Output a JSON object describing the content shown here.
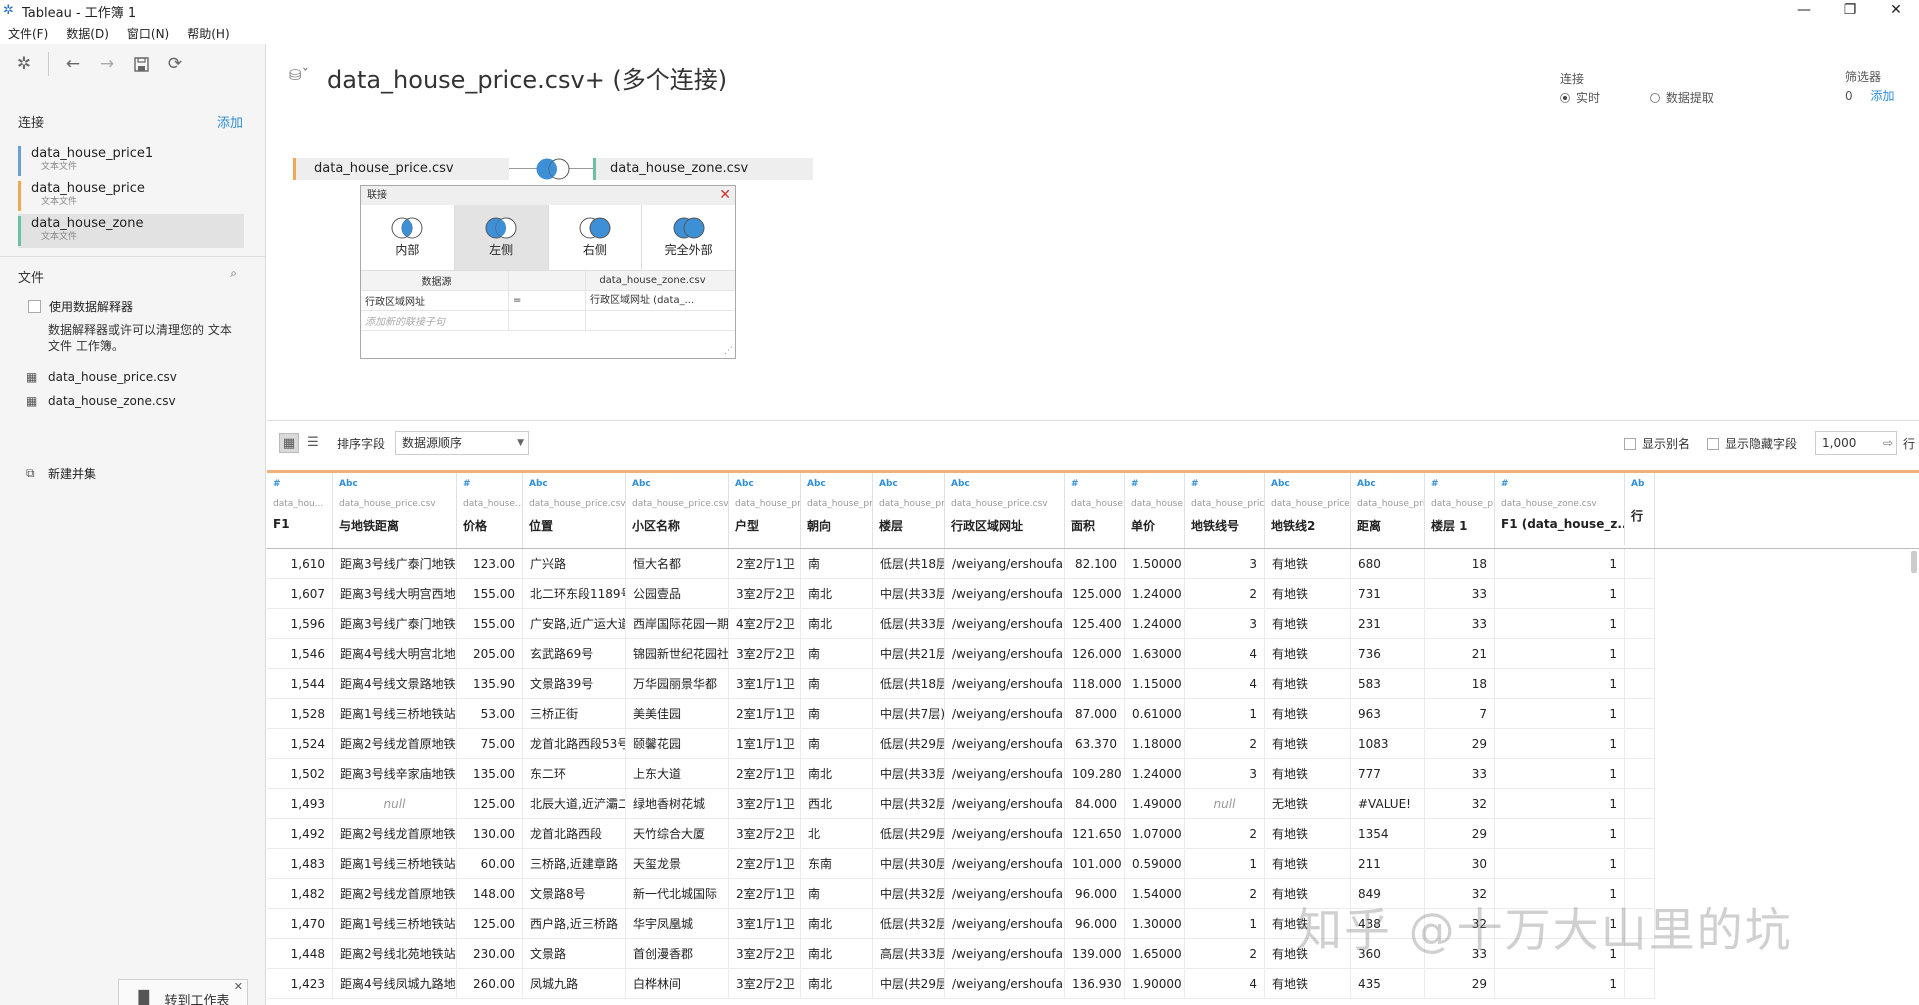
{
  "window": {
    "title": "Tableau - 工作簿 1",
    "controls": [
      "—",
      "❐",
      "✕"
    ]
  },
  "menu": [
    "文件(F)",
    "数据(D)",
    "窗口(N)",
    "帮助(H)"
  ],
  "sidebar": {
    "connections_title": "连接",
    "add_label": "添加",
    "connections": [
      {
        "name": "data_house_price1",
        "sub": "文本文件",
        "color": "#6a9fd8"
      },
      {
        "name": "data_house_price",
        "sub": "文本文件",
        "color": "#f0a856"
      },
      {
        "name": "data_house_zone",
        "sub": "文本文件",
        "color": "#6cc0a3"
      }
    ],
    "files_title": "文件",
    "interpreter_label": "使用数据解释器",
    "interpreter_desc_1": "数据解释器或许可以清理您的 文本",
    "interpreter_desc_2": "文件 工作簿。",
    "files": [
      "data_house_price.csv",
      "data_house_zone.csv"
    ],
    "new_union": "新建并集",
    "goto_sheet": "转到工作表"
  },
  "canvas": {
    "title": "data_house_price.csv+ (多个连接)",
    "connection_label": "连接",
    "mode_live": "实时",
    "mode_extract": "数据提取",
    "filter_label": "筛选器",
    "filter_count": "0",
    "filter_add": "添加",
    "left_table": "data_house_price.csv",
    "right_table": "data_house_zone.csv",
    "colors": {
      "left": "#f0a856",
      "right": "#6cc0a3",
      "venn": "#3d8fd6"
    }
  },
  "join_dialog": {
    "title": "联接",
    "types": [
      "内部",
      "左侧",
      "右侧",
      "完全外部"
    ],
    "active_type": 1,
    "col_source": "数据源",
    "col_right": "data_house_zone.csv",
    "clause_left": "行政区域网址",
    "clause_op": "=",
    "clause_right": "行政区域网址 (data_...",
    "add_clause": "添加新的联接子句"
  },
  "grid_toolbar": {
    "sort_label": "排序字段",
    "sort_value": "数据源顺序",
    "show_alias": "显示别名",
    "show_hidden": "显示隐藏字段",
    "rows_value": "1,000",
    "rows_label": "行"
  },
  "columns": [
    {
      "type": "#",
      "src": "data_hou...",
      "name": "F1"
    },
    {
      "type": "Abc",
      "src": "data_house_price.csv",
      "name": "与地铁距离"
    },
    {
      "type": "#",
      "src": "data_house...",
      "name": "价格"
    },
    {
      "type": "Abc",
      "src": "data_house_price.csv",
      "name": "位置"
    },
    {
      "type": "Abc",
      "src": "data_house_price.csv",
      "name": "小区名称"
    },
    {
      "type": "Abc",
      "src": "data_house_pri...",
      "name": "户型"
    },
    {
      "type": "Abc",
      "src": "data_house_pri...",
      "name": "朝向"
    },
    {
      "type": "Abc",
      "src": "data_house_pri...",
      "name": "楼层"
    },
    {
      "type": "Abc",
      "src": "data_house_price.csv",
      "name": "行政区域网址"
    },
    {
      "type": "#",
      "src": "data_house...",
      "name": "面积"
    },
    {
      "type": "#",
      "src": "data_house...",
      "name": "单价"
    },
    {
      "type": "#",
      "src": "data_house_price...",
      "name": "地铁线号"
    },
    {
      "type": "Abc",
      "src": "data_house_price.csv",
      "name": "地铁线2"
    },
    {
      "type": "Abc",
      "src": "data_house_pri...",
      "name": "距离"
    },
    {
      "type": "#",
      "src": "data_house_p...",
      "name": "楼层 1"
    },
    {
      "type": "#",
      "src": "data_house_zone.csv",
      "name": "F1 (data_house_z..."
    },
    {
      "type": "Ab",
      "src": "",
      "name": "行"
    }
  ],
  "rows": [
    [
      "1,610",
      "距离3号线广泰门地铁...",
      "123.00",
      "广兴路",
      "恒大名都",
      "2室2厅1卫",
      "南",
      "低层(共18层)",
      "/weiyang/ershoufang/",
      "82.100",
      "1.50000",
      "3",
      "有地铁",
      "680",
      "18",
      "1"
    ],
    [
      "1,607",
      "距离3号线大明宫西地...",
      "155.00",
      "北二环东段1189号",
      "公园壹品",
      "3室2厅2卫",
      "南北",
      "中层(共33层)",
      "/weiyang/ershoufang/",
      "125.000",
      "1.24000",
      "2",
      "有地铁",
      "731",
      "33",
      "1"
    ],
    [
      "1,596",
      "距离3号线广泰门地铁...",
      "155.00",
      "广安路,近广运大道",
      "西岸国际花园一期",
      "4室2厅2卫",
      "南北",
      "低层(共33层)",
      "/weiyang/ershoufang/",
      "125.400",
      "1.24000",
      "3",
      "有地铁",
      "231",
      "33",
      "1"
    ],
    [
      "1,546",
      "距离4号线大明宫北地...",
      "205.00",
      "玄武路69号",
      "锦园新世纪花园社区",
      "3室2厅2卫",
      "南",
      "中层(共21层)",
      "/weiyang/ershoufang/",
      "126.000",
      "1.63000",
      "4",
      "有地铁",
      "736",
      "21",
      "1"
    ],
    [
      "1,544",
      "距离4号线文景路地铁...",
      "135.90",
      "文景路39号",
      "万华园丽景华都",
      "3室1厅1卫",
      "南",
      "低层(共18层)",
      "/weiyang/ershoufang/",
      "118.000",
      "1.15000",
      "4",
      "有地铁",
      "583",
      "18",
      "1"
    ],
    [
      "1,528",
      "距离1号线三桥地铁站9...",
      "53.00",
      "三桥正街",
      "美美佳园",
      "2室1厅1卫",
      "南",
      "中层(共7层)",
      "/weiyang/ershoufang/",
      "87.000",
      "0.61000",
      "1",
      "有地铁",
      "963",
      "7",
      "1"
    ],
    [
      "1,524",
      "距离2号线龙首原地铁...",
      "75.00",
      "龙首北路西段53号",
      "颐馨花园",
      "1室1厅1卫",
      "南",
      "低层(共29层)",
      "/weiyang/ershoufang/",
      "63.370",
      "1.18000",
      "2",
      "有地铁",
      "1083",
      "29",
      "1"
    ],
    [
      "1,502",
      "距离3号线辛家庙地铁...",
      "135.00",
      "东二环",
      "上东大道",
      "2室2厅1卫",
      "南北",
      "中层(共33层)",
      "/weiyang/ershoufang/",
      "109.280",
      "1.24000",
      "3",
      "有地铁",
      "777",
      "33",
      "1"
    ],
    [
      "1,493",
      "null",
      "125.00",
      "北辰大道,近浐灞二路",
      "绿地香树花城",
      "3室2厅1卫",
      "西北",
      "中层(共32层)",
      "/weiyang/ershoufang/",
      "84.000",
      "1.49000",
      "null",
      "无地铁",
      "#VALUE!",
      "32",
      "1"
    ],
    [
      "1,492",
      "距离2号线龙首原地铁...",
      "130.00",
      "龙首北路西段",
      "天竹综合大厦",
      "3室2厅2卫",
      "北",
      "低层(共29层)",
      "/weiyang/ershoufang/",
      "121.650",
      "1.07000",
      "2",
      "有地铁",
      "1354",
      "29",
      "1"
    ],
    [
      "1,483",
      "距离1号线三桥地铁站2...",
      "60.00",
      "三桥路,近建章路",
      "天玺龙景",
      "2室2厅1卫",
      "东南",
      "中层(共30层)",
      "/weiyang/ershoufang/",
      "101.000",
      "0.59000",
      "1",
      "有地铁",
      "211",
      "30",
      "1"
    ],
    [
      "1,482",
      "距离2号线龙首原地铁...",
      "148.00",
      "文景路8号",
      "新一代北城国际",
      "2室2厅1卫",
      "南",
      "中层(共32层)",
      "/weiyang/ershoufang/",
      "96.000",
      "1.54000",
      "2",
      "有地铁",
      "849",
      "32",
      "1"
    ],
    [
      "1,470",
      "距离1号线三桥地铁站4...",
      "125.00",
      "西户路,近三桥路",
      "华宇凤凰城",
      "3室1厅1卫",
      "南北",
      "低层(共32层)",
      "/weiyang/ershoufang/",
      "96.000",
      "1.30000",
      "1",
      "有地铁",
      "438",
      "32",
      "1"
    ],
    [
      "1,448",
      "距离2号线北苑地铁站3...",
      "230.00",
      "文景路",
      "首创漫香郡",
      "3室2厅2卫",
      "南北",
      "高层(共33层)",
      "/weiyang/ershoufang/",
      "139.000",
      "1.65000",
      "2",
      "有地铁",
      "360",
      "33",
      "1"
    ],
    [
      "1,423",
      "距离4号线凤城九路地...",
      "260.00",
      "凤城九路",
      "白桦林间",
      "3室2厅2卫",
      "南北",
      "中层(共29层)",
      "/weiyang/ershoufang/",
      "136.930",
      "1.90000",
      "4",
      "有地铁",
      "435",
      "29",
      "1"
    ]
  ],
  "watermark": "知乎 @十万大山里的坑"
}
